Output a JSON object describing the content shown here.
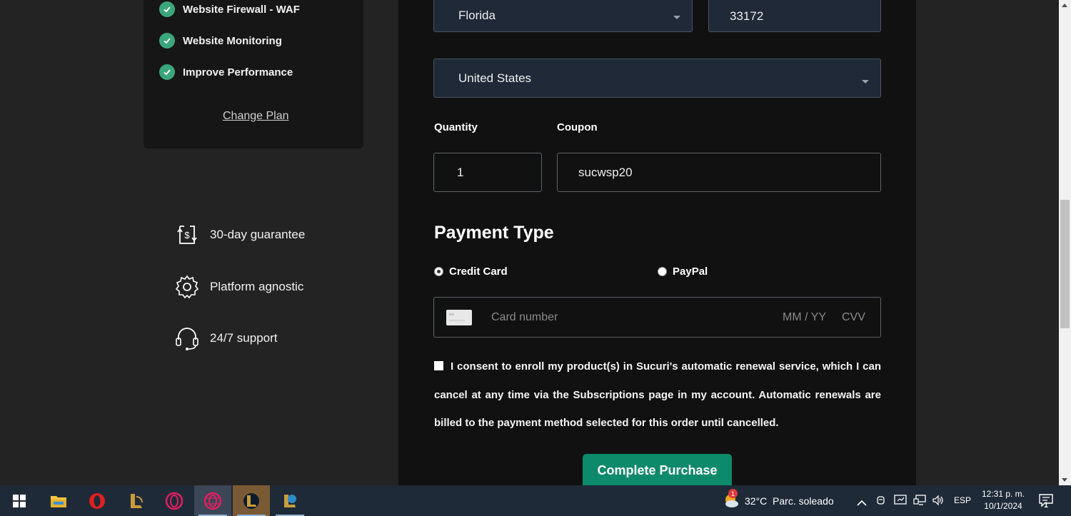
{
  "plan": {
    "features": [
      "Website Firewall - WAF",
      "Website Monitoring",
      "Improve Performance"
    ],
    "change_plan": "Change Plan"
  },
  "benefits": {
    "guarantee": "30-day guarantee",
    "agnostic": "Platform agnostic",
    "support": "24/7 support"
  },
  "form": {
    "state": "Florida",
    "zip": "33172",
    "country": "United States",
    "quantity_label": "Quantity",
    "coupon_label": "Coupon",
    "quantity": "1",
    "coupon": "sucwsp20",
    "payment_title": "Payment Type",
    "payment_options": [
      "Credit Card",
      "PayPal"
    ],
    "card_placeholder": "Card number",
    "expiry_placeholder": "MM / YY",
    "cvv_placeholder": "CVV",
    "consent": "I consent to enroll my product(s) in Sucuri's automatic renewal service, which I can cancel at any time via the Subscriptions page in my account. Automatic renewals are billed to the payment method selected for this order until cancelled.",
    "submit": "Complete Purchase"
  },
  "taskbar": {
    "weather_badge": "1",
    "weather": "32°C  Parc. soleado",
    "lang": "ESP",
    "time": "12:31 p. m.",
    "date": "10/1/2024",
    "notifications": "1"
  },
  "colors": {
    "accent": "#0d8a6a",
    "check": "#3aa67b",
    "taskbar": "#1f2a38"
  }
}
